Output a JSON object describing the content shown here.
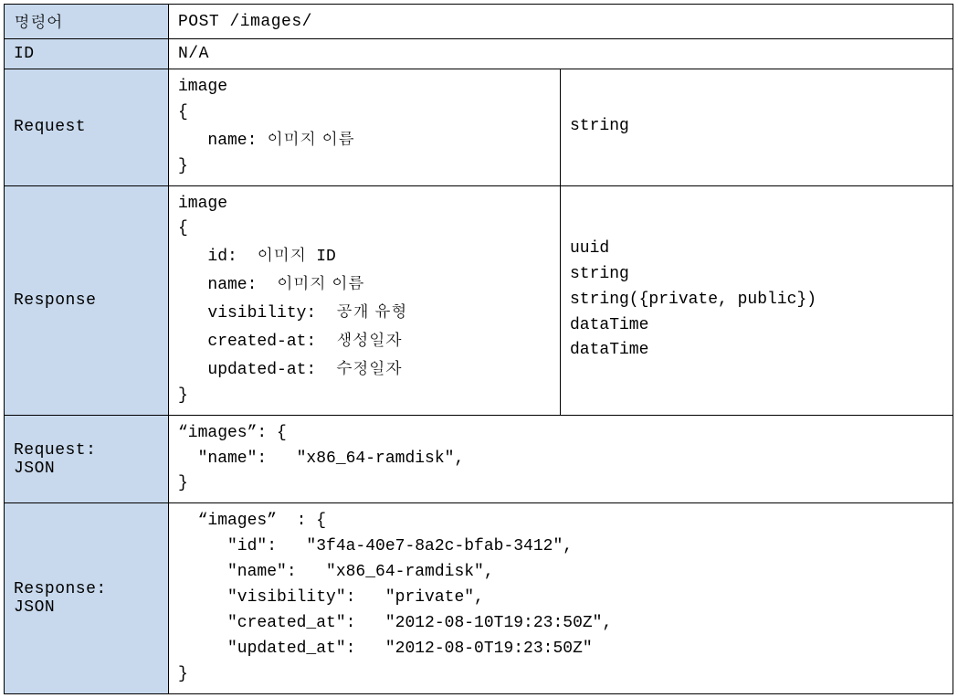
{
  "rows": {
    "command": {
      "label": "명령어",
      "value": "POST /images/"
    },
    "id": {
      "label": "ID",
      "value": "N/A"
    },
    "request": {
      "label": "Request",
      "body_html": "image\n{\n   name: <span class=\"han\">이미지 이름</span>\n}",
      "types": "string"
    },
    "response": {
      "label": "Response",
      "body_html": "image\n{\n   id:  <span class=\"han\">이미지</span> ID\n   name:  <span class=\"han\">이미지 이름</span>\n   visibility:  <span class=\"han\">공개 유형</span>\n   created-at:  <span class=\"han\">생성일자</span>\n   updated-at:  <span class=\"han\">수정일자</span>\n}",
      "types": "uuid\nstring\nstring({private, public})\ndataTime\ndataTime"
    },
    "request_json": {
      "label": "Request:\nJSON",
      "body": "“images”: {\n  \"name\":   \"x86_64-ramdisk\",\n}"
    },
    "response_json": {
      "label": "Response:\nJSON",
      "body": "  “images”  : {\n     \"id\":   \"3f4a-40e7-8a2c-bfab-3412\",\n     \"name\":   \"x86_64-ramdisk\",\n     \"visibility\":   \"private\",\n     \"created_at\":   \"2012-08-10T19:23:50Z\",\n     \"updated_at\":   \"2012-08-0T19:23:50Z\"\n}"
    }
  }
}
